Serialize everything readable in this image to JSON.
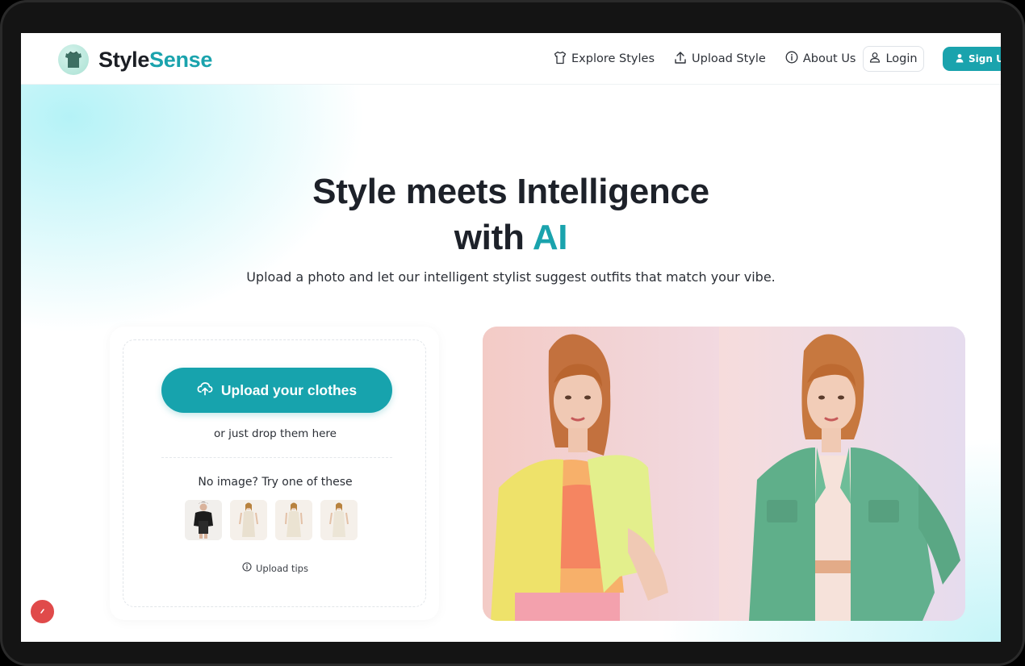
{
  "brand": {
    "name_part1": "Style",
    "name_part2": "Sense",
    "accent_color": "#1aa3ad"
  },
  "nav": {
    "items": [
      {
        "label": "Explore Styles",
        "icon": "shirt-icon"
      },
      {
        "label": "Upload Style",
        "icon": "upload-icon"
      },
      {
        "label": "About Us",
        "icon": "info-icon"
      }
    ],
    "login_label": "Login",
    "signup_label": "Sign Up"
  },
  "hero": {
    "title_line1": "Style meets Intelligence",
    "title_line2_prefix": "with ",
    "title_line2_accent": "AI",
    "subtitle": "Upload a photo and let our intelligent stylist suggest outfits that match your vibe."
  },
  "upload": {
    "button_label": "Upload your clothes",
    "drop_text": "or just drop them here",
    "try_text": "No image? Try one of these",
    "samples": [
      "black-top",
      "cream-dress",
      "cream-dress",
      "cream-dress"
    ],
    "tips_label": "Upload tips"
  },
  "photo": {
    "left_outfit": "yellow-green blazer with orange top",
    "right_outfit": "green denim jacket"
  },
  "colors": {
    "teal": "#1aa3ad",
    "text_dark": "#1d2129",
    "floating_button": "#e04a4a"
  }
}
